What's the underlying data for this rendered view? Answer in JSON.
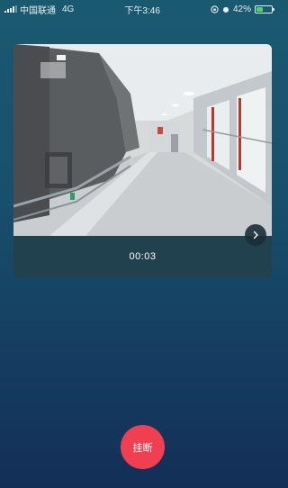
{
  "status_bar": {
    "carrier": "中国联通",
    "network": "4G",
    "time": "下午3:46",
    "battery_text": "42%",
    "battery_level": 0.42
  },
  "call": {
    "elapsed": "00:03",
    "hangup_label": "挂断"
  },
  "colors": {
    "hangup": "#ef3f50",
    "background_top": "#1a5a70",
    "background_bottom": "#132f57"
  }
}
